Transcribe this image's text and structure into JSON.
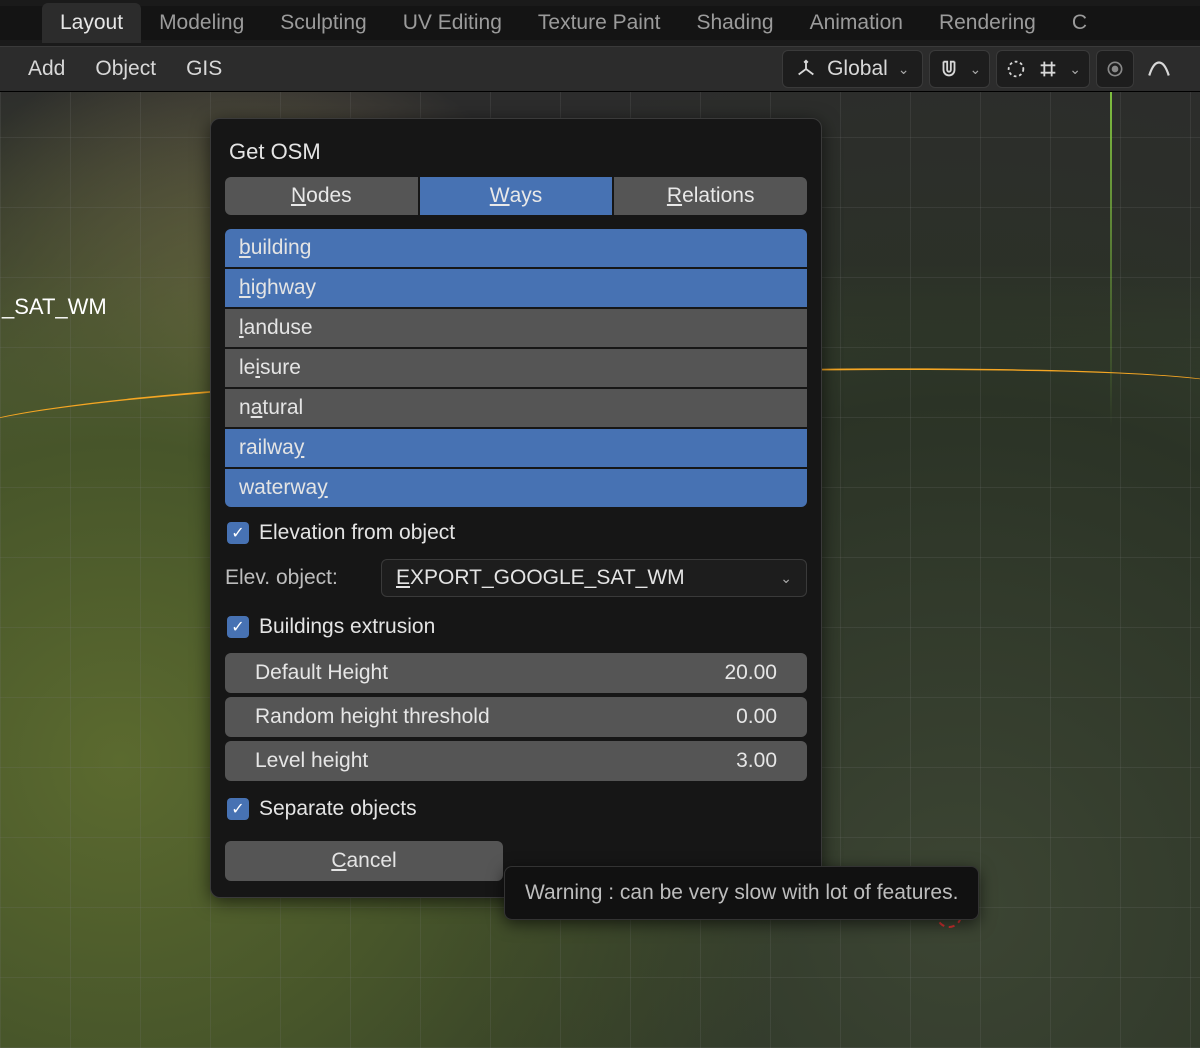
{
  "workspace_tabs": {
    "items": [
      "Layout",
      "Modeling",
      "Sculpting",
      "UV Editing",
      "Texture Paint",
      "Shading",
      "Animation",
      "Rendering",
      "C"
    ],
    "active_index": 0
  },
  "toolbar": {
    "left": {
      "add": "Add",
      "object": "Object",
      "gis": "GIS"
    },
    "right": {
      "orientation_label": "Global"
    }
  },
  "viewport": {
    "object_label": "_SAT_WM"
  },
  "panel": {
    "title": "Get OSM",
    "segments": {
      "nodes": {
        "pre": "",
        "u": "N",
        "post": "odes"
      },
      "ways": {
        "pre": "",
        "u": "W",
        "post": "ays"
      },
      "relations": {
        "pre": "",
        "u": "R",
        "post": "elations"
      }
    },
    "active_segment": "ways",
    "tags": [
      {
        "pre": "",
        "u": "b",
        "post": "uilding",
        "selected": true
      },
      {
        "pre": "",
        "u": "h",
        "post": "ighway",
        "selected": true
      },
      {
        "pre": "",
        "u": "l",
        "post": "anduse",
        "selected": false
      },
      {
        "pre": "le",
        "u": "i",
        "post": "sure",
        "selected": false
      },
      {
        "pre": "n",
        "u": "a",
        "post": "tural",
        "selected": false
      },
      {
        "pre": "railwa",
        "u": "y",
        "post": "",
        "selected": true
      },
      {
        "pre": "waterwa",
        "u": "y",
        "post": "",
        "selected": true
      }
    ],
    "elevation_label": "Elevation from object",
    "elev_object_label": "Elev. object:",
    "elev_object_select": {
      "u": "E",
      "post": "XPORT_GOOGLE_SAT_WM"
    },
    "extrusion_label": "Buildings extrusion",
    "num_fields": [
      {
        "label": "Default Height",
        "value": "20.00"
      },
      {
        "label": "Random height threshold",
        "value": "0.00"
      },
      {
        "label": "Level height",
        "value": "3.00"
      }
    ],
    "separate_label": "Separate objects",
    "cancel": {
      "u": "C",
      "post": "ancel"
    }
  },
  "tooltip": "Warning : can be very slow with lot of features."
}
